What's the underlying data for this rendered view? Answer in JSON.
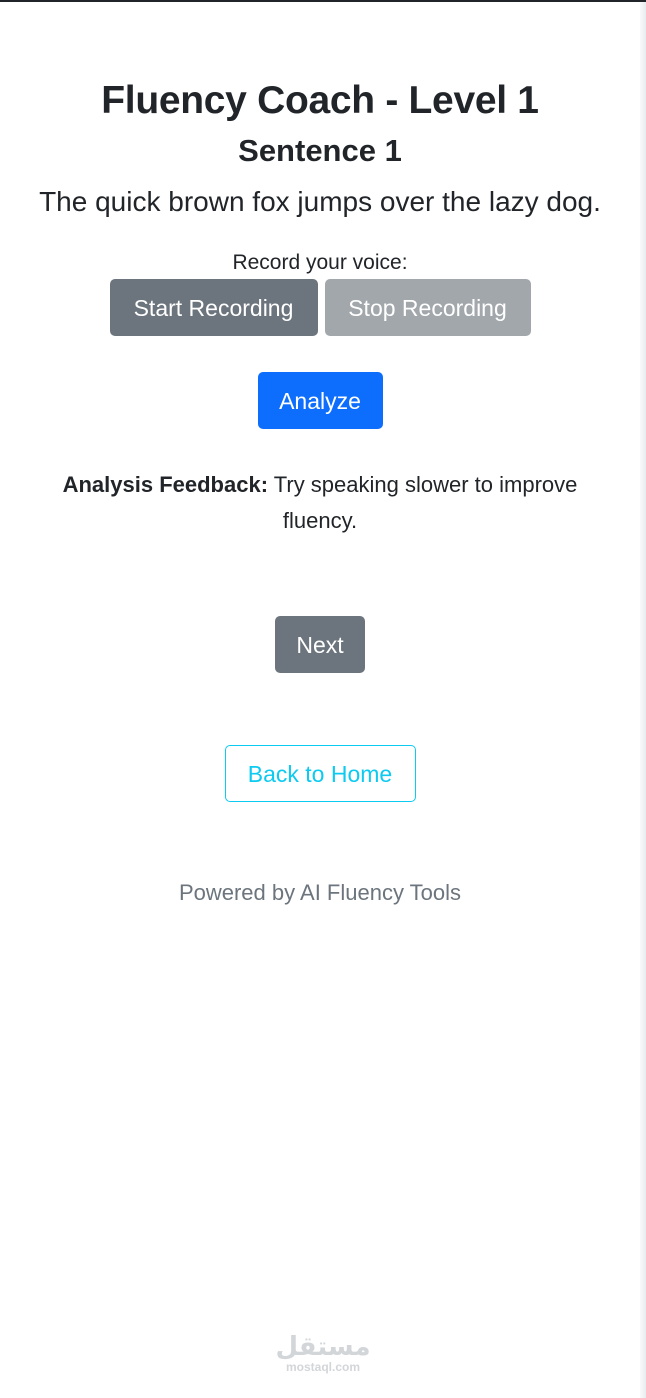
{
  "header": {
    "title": "Fluency Coach - Level 1",
    "subtitle": "Sentence 1"
  },
  "sentence": "The quick brown fox jumps over the lazy dog.",
  "recording": {
    "label": "Record your voice:",
    "start_label": "Start Recording",
    "stop_label": "Stop Recording"
  },
  "analyze_label": "Analyze",
  "feedback": {
    "label": "Analysis Feedback:",
    "text": "Try speaking slower to improve fluency."
  },
  "next_label": "Next",
  "home_label": "Back to Home",
  "footer": "Powered by AI Fluency Tools",
  "watermark": {
    "arabic": "مستقل",
    "latin": "mostaql.com"
  },
  "colors": {
    "primary": "#0d6efd",
    "secondary": "#6c757d",
    "secondary_disabled": "#a2a7ac",
    "info": "#0dcaf0",
    "text": "#212529"
  }
}
